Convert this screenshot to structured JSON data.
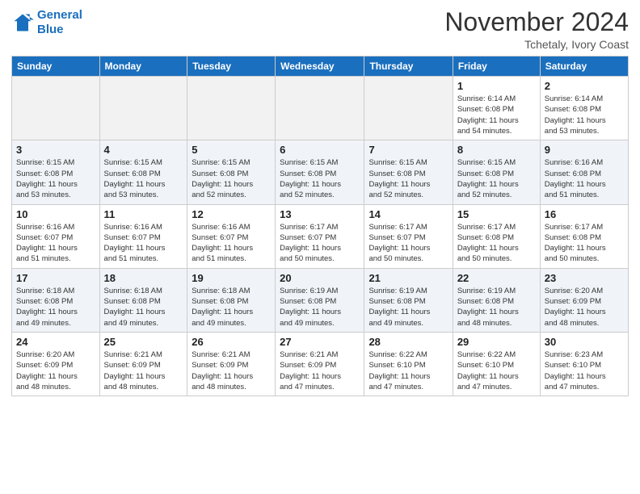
{
  "header": {
    "logo_line1": "General",
    "logo_line2": "Blue",
    "month_title": "November 2024",
    "location": "Tchetaly, Ivory Coast"
  },
  "weekdays": [
    "Sunday",
    "Monday",
    "Tuesday",
    "Wednesday",
    "Thursday",
    "Friday",
    "Saturday"
  ],
  "weeks": [
    [
      {
        "day": "",
        "info": ""
      },
      {
        "day": "",
        "info": ""
      },
      {
        "day": "",
        "info": ""
      },
      {
        "day": "",
        "info": ""
      },
      {
        "day": "",
        "info": ""
      },
      {
        "day": "1",
        "info": "Sunrise: 6:14 AM\nSunset: 6:08 PM\nDaylight: 11 hours\nand 54 minutes."
      },
      {
        "day": "2",
        "info": "Sunrise: 6:14 AM\nSunset: 6:08 PM\nDaylight: 11 hours\nand 53 minutes."
      }
    ],
    [
      {
        "day": "3",
        "info": "Sunrise: 6:15 AM\nSunset: 6:08 PM\nDaylight: 11 hours\nand 53 minutes."
      },
      {
        "day": "4",
        "info": "Sunrise: 6:15 AM\nSunset: 6:08 PM\nDaylight: 11 hours\nand 53 minutes."
      },
      {
        "day": "5",
        "info": "Sunrise: 6:15 AM\nSunset: 6:08 PM\nDaylight: 11 hours\nand 52 minutes."
      },
      {
        "day": "6",
        "info": "Sunrise: 6:15 AM\nSunset: 6:08 PM\nDaylight: 11 hours\nand 52 minutes."
      },
      {
        "day": "7",
        "info": "Sunrise: 6:15 AM\nSunset: 6:08 PM\nDaylight: 11 hours\nand 52 minutes."
      },
      {
        "day": "8",
        "info": "Sunrise: 6:15 AM\nSunset: 6:08 PM\nDaylight: 11 hours\nand 52 minutes."
      },
      {
        "day": "9",
        "info": "Sunrise: 6:16 AM\nSunset: 6:08 PM\nDaylight: 11 hours\nand 51 minutes."
      }
    ],
    [
      {
        "day": "10",
        "info": "Sunrise: 6:16 AM\nSunset: 6:07 PM\nDaylight: 11 hours\nand 51 minutes."
      },
      {
        "day": "11",
        "info": "Sunrise: 6:16 AM\nSunset: 6:07 PM\nDaylight: 11 hours\nand 51 minutes."
      },
      {
        "day": "12",
        "info": "Sunrise: 6:16 AM\nSunset: 6:07 PM\nDaylight: 11 hours\nand 51 minutes."
      },
      {
        "day": "13",
        "info": "Sunrise: 6:17 AM\nSunset: 6:07 PM\nDaylight: 11 hours\nand 50 minutes."
      },
      {
        "day": "14",
        "info": "Sunrise: 6:17 AM\nSunset: 6:07 PM\nDaylight: 11 hours\nand 50 minutes."
      },
      {
        "day": "15",
        "info": "Sunrise: 6:17 AM\nSunset: 6:08 PM\nDaylight: 11 hours\nand 50 minutes."
      },
      {
        "day": "16",
        "info": "Sunrise: 6:17 AM\nSunset: 6:08 PM\nDaylight: 11 hours\nand 50 minutes."
      }
    ],
    [
      {
        "day": "17",
        "info": "Sunrise: 6:18 AM\nSunset: 6:08 PM\nDaylight: 11 hours\nand 49 minutes."
      },
      {
        "day": "18",
        "info": "Sunrise: 6:18 AM\nSunset: 6:08 PM\nDaylight: 11 hours\nand 49 minutes."
      },
      {
        "day": "19",
        "info": "Sunrise: 6:18 AM\nSunset: 6:08 PM\nDaylight: 11 hours\nand 49 minutes."
      },
      {
        "day": "20",
        "info": "Sunrise: 6:19 AM\nSunset: 6:08 PM\nDaylight: 11 hours\nand 49 minutes."
      },
      {
        "day": "21",
        "info": "Sunrise: 6:19 AM\nSunset: 6:08 PM\nDaylight: 11 hours\nand 49 minutes."
      },
      {
        "day": "22",
        "info": "Sunrise: 6:19 AM\nSunset: 6:08 PM\nDaylight: 11 hours\nand 48 minutes."
      },
      {
        "day": "23",
        "info": "Sunrise: 6:20 AM\nSunset: 6:09 PM\nDaylight: 11 hours\nand 48 minutes."
      }
    ],
    [
      {
        "day": "24",
        "info": "Sunrise: 6:20 AM\nSunset: 6:09 PM\nDaylight: 11 hours\nand 48 minutes."
      },
      {
        "day": "25",
        "info": "Sunrise: 6:21 AM\nSunset: 6:09 PM\nDaylight: 11 hours\nand 48 minutes."
      },
      {
        "day": "26",
        "info": "Sunrise: 6:21 AM\nSunset: 6:09 PM\nDaylight: 11 hours\nand 48 minutes."
      },
      {
        "day": "27",
        "info": "Sunrise: 6:21 AM\nSunset: 6:09 PM\nDaylight: 11 hours\nand 47 minutes."
      },
      {
        "day": "28",
        "info": "Sunrise: 6:22 AM\nSunset: 6:10 PM\nDaylight: 11 hours\nand 47 minutes."
      },
      {
        "day": "29",
        "info": "Sunrise: 6:22 AM\nSunset: 6:10 PM\nDaylight: 11 hours\nand 47 minutes."
      },
      {
        "day": "30",
        "info": "Sunrise: 6:23 AM\nSunset: 6:10 PM\nDaylight: 11 hours\nand 47 minutes."
      }
    ]
  ]
}
